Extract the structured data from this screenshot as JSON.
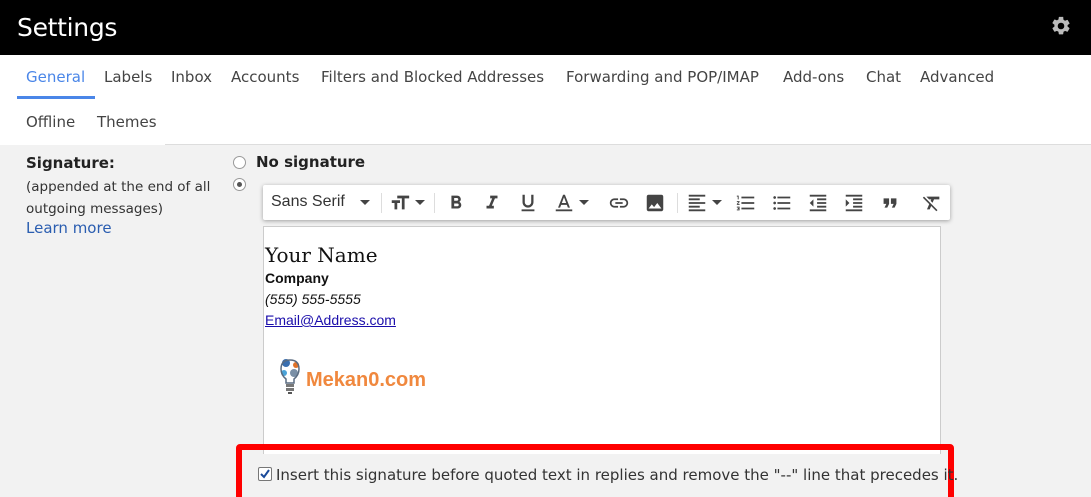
{
  "header": {
    "title": "Settings",
    "settings_icon": "gear-icon"
  },
  "tabs": [
    {
      "label": "General",
      "active": true
    },
    {
      "label": "Labels"
    },
    {
      "label": "Inbox"
    },
    {
      "label": "Accounts"
    },
    {
      "label": "Filters and Blocked Addresses"
    },
    {
      "label": "Forwarding and POP/IMAP"
    },
    {
      "label": "Add-ons"
    },
    {
      "label": "Chat"
    },
    {
      "label": "Advanced"
    },
    {
      "label": "Offline"
    },
    {
      "label": "Themes"
    }
  ],
  "signature": {
    "label": "Signature:",
    "description": "(appended at the end of all outgoing messages)",
    "learn_more": "Learn more",
    "options": {
      "no_signature": "No signature",
      "selected": "custom"
    },
    "toolbar": {
      "font": "Sans Serif",
      "icons": [
        "text-size-icon",
        "bold-icon",
        "italic-icon",
        "underline-icon",
        "text-color-icon",
        "link-icon",
        "image-icon",
        "align-icon",
        "numbered-list-icon",
        "bulleted-list-icon",
        "indent-less-icon",
        "indent-more-icon",
        "quote-icon",
        "remove-formatting-icon"
      ]
    },
    "content": {
      "name": "Your Name",
      "company": "Company",
      "phone": "(555) 555-5555",
      "email": "Email@Address.com",
      "logo_text": "Mekan0.com"
    },
    "insert_before_quoted": {
      "checked": true,
      "label": "Insert this signature before quoted text in replies and remove the \"--\" line that precedes it."
    }
  },
  "colors": {
    "accent": "#4a86e8",
    "highlight": "#ff0000",
    "logo": "#f0883e"
  }
}
